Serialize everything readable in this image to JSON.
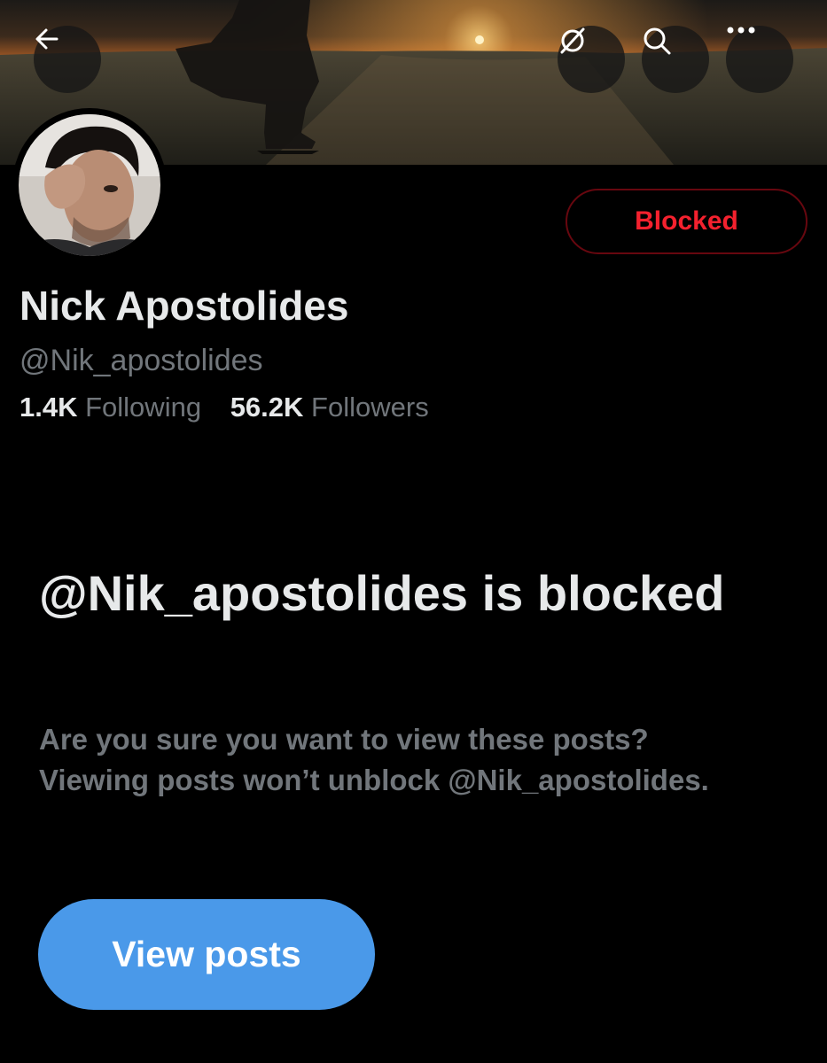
{
  "header": {
    "icons": [
      "back-arrow-icon",
      "grok-icon",
      "search-icon",
      "more-icon"
    ]
  },
  "profile": {
    "display_name": "Nick Apostolides",
    "handle": "@Nik_apostolides",
    "following_count": "1.4K",
    "following_label": "Following",
    "followers_count": "56.2K",
    "followers_label": "Followers",
    "relationship_button": "Blocked"
  },
  "blocked_notice": {
    "title": "@Nik_apostolides is blocked",
    "description": "Are you sure you want to view these posts? Viewing posts won’t unblock @Nik_apostolides.",
    "action_label": "View posts"
  },
  "colors": {
    "background": "#000000",
    "primary_text": "#e7e9ea",
    "secondary_text": "#71767b",
    "blocked_red": "#f4212e",
    "blocked_border": "#67070f",
    "accent_blue": "#4a99e9"
  }
}
